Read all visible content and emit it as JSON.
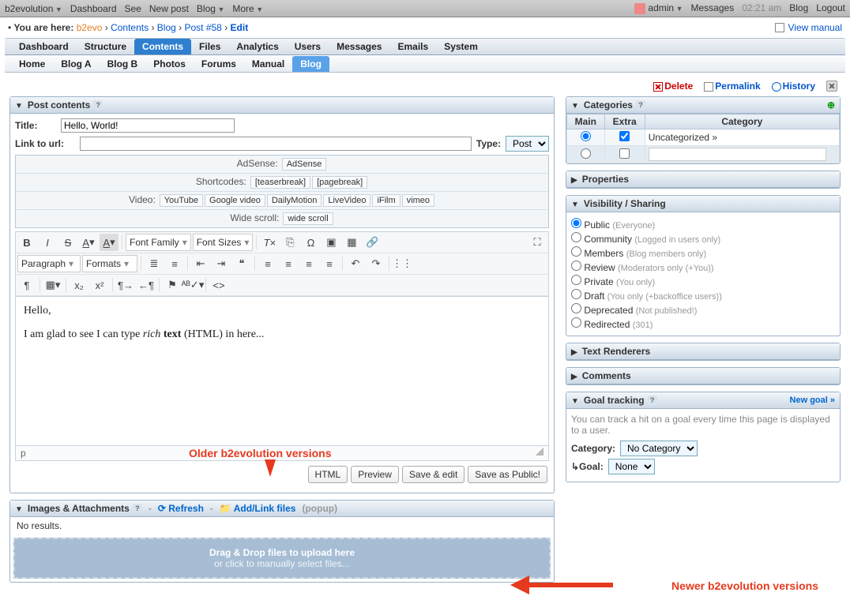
{
  "topbar": {
    "brand": "b2evolution",
    "items": [
      "Dashboard",
      "See",
      "New post",
      "Blog",
      "More"
    ],
    "user": "admin",
    "messages": "Messages",
    "time": "02:21 am",
    "blog": "Blog",
    "logout": "Logout"
  },
  "breadcrumb": {
    "prefix": "You are here:",
    "b2": "b2evo",
    "contents": "Contents",
    "blog": "Blog",
    "post": "Post #58",
    "edit": "Edit",
    "manual": "View manual"
  },
  "tabs1": [
    "Dashboard",
    "Structure",
    "Contents",
    "Files",
    "Analytics",
    "Users",
    "Messages",
    "Emails",
    "System"
  ],
  "tabs1_active": 2,
  "tabs2": [
    "Home",
    "Blog A",
    "Blog B",
    "Photos",
    "Forums",
    "Manual",
    "Blog"
  ],
  "tabs2_active": 6,
  "actions": {
    "delete": "Delete",
    "permalink": "Permalink",
    "history": "History"
  },
  "post": {
    "panel_title": "Post contents",
    "title_label": "Title:",
    "title_value": "Hello, World!",
    "link_label": "Link to url:",
    "link_value": "",
    "type_label": "Type:",
    "type_value": "Post",
    "adsense_label": "AdSense:",
    "adsense_btn": "AdSense",
    "shortcodes_label": "Shortcodes:",
    "shortcodes": [
      "[teaserbreak]",
      "[pagebreak]"
    ],
    "video_label": "Video:",
    "video": [
      "YouTube",
      "Google video",
      "DailyMotion",
      "LiveVideo",
      "iFilm",
      "vimeo"
    ],
    "widescroll_label": "Wide scroll:",
    "widescroll_btn": "wide scroll",
    "rte": {
      "font_family": "Font Family",
      "font_sizes": "Font Sizes",
      "paragraph": "Paragraph",
      "formats": "Formats"
    },
    "content_p1": "Hello,",
    "content_p2_a": "I am glad to see I can type ",
    "content_p2_b": "rich",
    "content_p2_c": " text",
    "content_p2_d": " (HTML) in here...",
    "status": "p",
    "buttons": [
      "HTML",
      "Preview",
      "Save & edit",
      "Save as Public!"
    ]
  },
  "annot_old": "Older b2evolution versions",
  "annot_new": "Newer b2evolution versions",
  "attach": {
    "title": "Images & Attachments",
    "refresh": "Refresh",
    "addlink": "Add/Link files",
    "popup": "(popup)",
    "none": "No results.",
    "dz1": "Drag & Drop files to upload here",
    "dz2": "or click to manually select files..."
  },
  "cats": {
    "title": "Categories",
    "cols": [
      "Main",
      "Extra",
      "Category"
    ],
    "row1": "Uncategorized  »"
  },
  "panels_closed": [
    "Properties",
    "Text Renderers",
    "Comments"
  ],
  "vis": {
    "title": "Visibility / Sharing",
    "options": [
      {
        "label": "Public",
        "note": "(Everyone)",
        "checked": true
      },
      {
        "label": "Community",
        "note": "(Logged in users only)"
      },
      {
        "label": "Members",
        "note": "(Blog members only)"
      },
      {
        "label": "Review",
        "note": "(Moderators only (+You))"
      },
      {
        "label": "Private",
        "note": "(You only)"
      },
      {
        "label": "Draft",
        "note": "(You only (+backoffice users))"
      },
      {
        "label": "Deprecated",
        "note": "(Not published!)"
      },
      {
        "label": "Redirected",
        "note": "(301)"
      }
    ]
  },
  "goal": {
    "title": "Goal tracking",
    "newgoal": "New goal »",
    "desc": "You can track a hit on a goal every time this page is displayed to a user.",
    "category_label": "Category:",
    "category_value": "No Category",
    "goal_label": "↳Goal:",
    "goal_value": "None"
  }
}
